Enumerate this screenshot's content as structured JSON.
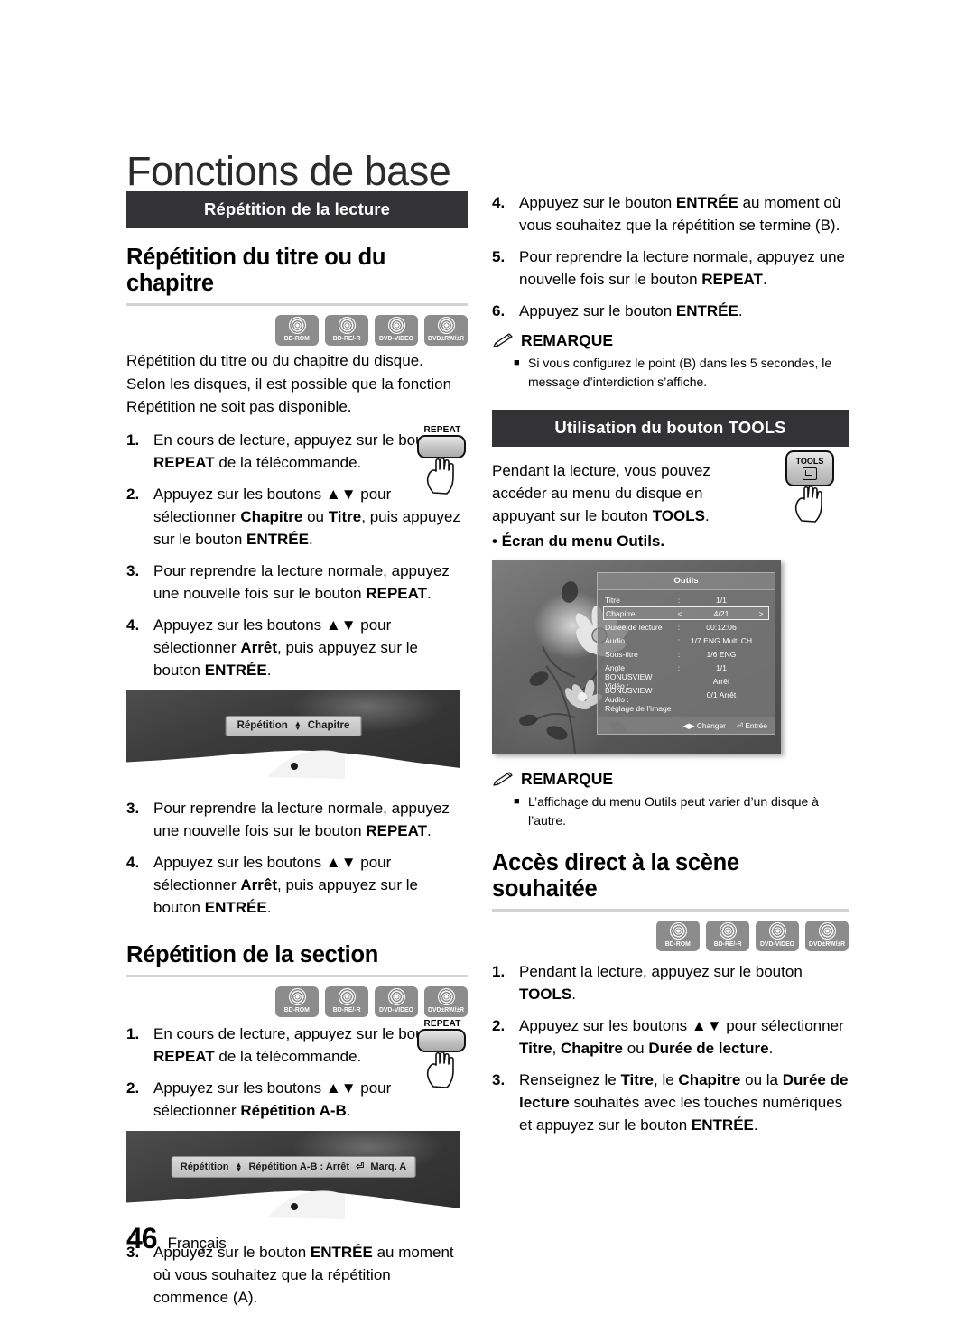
{
  "page": {
    "title": "Fonctions de base",
    "folio": "46",
    "language": "Français"
  },
  "disc_icons": [
    {
      "label": "BD-ROM"
    },
    {
      "label": "BD-RE/-R"
    },
    {
      "label": "DVD-VIDEO"
    },
    {
      "label": "DVD±RW/±R"
    }
  ],
  "left": {
    "section_bar": "Répétition de la lecture",
    "heading1": "Répétition du titre ou du chapitre",
    "intro1": "Répétition du titre ou du chapitre du disque.",
    "intro2": "Selon les disques, il est possible que la fonction Répétition ne soit pas disponible.",
    "steps": [
      {
        "num": "1.",
        "parts": [
          {
            "t": "En cours de lecture, appuyez sur le bouton "
          },
          {
            "t": "REPEAT",
            "b": true
          },
          {
            "t": " de la télécommande."
          }
        ]
      },
      {
        "num": "2.",
        "parts": [
          {
            "t": "Appuyez sur les boutons ▲▼ pour sélectionner "
          },
          {
            "t": "Chapitre",
            "b": true
          },
          {
            "t": " ou "
          },
          {
            "t": "Titre",
            "b": true
          },
          {
            "t": ", puis appuyez sur le bouton "
          },
          {
            "t": "ENTRÉE",
            "b": true
          },
          {
            "t": "."
          }
        ]
      },
      {
        "num": "3.",
        "parts": [
          {
            "t": "Pour reprendre la lecture normale, appuyez une nouvelle fois sur le bouton "
          },
          {
            "t": "REPEAT",
            "b": true
          },
          {
            "t": "."
          }
        ]
      },
      {
        "num": "4.",
        "parts": [
          {
            "t": "Appuyez sur les boutons ▲▼ pour sélectionner "
          },
          {
            "t": "Arrêt",
            "b": true
          },
          {
            "t": ", puis appuyez sur le bouton "
          },
          {
            "t": "ENTRÉE",
            "b": true
          },
          {
            "t": "."
          }
        ]
      }
    ],
    "osd1": {
      "label": "Répétition",
      "value": "Chapitre"
    },
    "heading2": "Répétition de la section",
    "steps2": [
      {
        "num": "1.",
        "parts": [
          {
            "t": "En cours de lecture, appuyez sur le bouton "
          },
          {
            "t": "REPEAT",
            "b": true
          },
          {
            "t": " de la télécommande."
          }
        ]
      },
      {
        "num": "2.",
        "parts": [
          {
            "t": "Appuyez sur les boutons ▲▼ pour sélectionner "
          },
          {
            "t": "Répétition A-B",
            "b": true
          },
          {
            "t": "."
          }
        ]
      },
      {
        "num": "3.",
        "parts": [
          {
            "t": "Appuyez sur le bouton "
          },
          {
            "t": "ENTRÉE",
            "b": true
          },
          {
            "t": " au moment où vous souhaitez que la répétition commence (A)."
          }
        ]
      }
    ],
    "osd2": {
      "label": "Répétition",
      "value": "Répétition A-B : Arrêt",
      "extra": "Marq. A"
    },
    "repeat_key_label": "REPEAT"
  },
  "right": {
    "steps_top": [
      {
        "num": "4.",
        "parts": [
          {
            "t": "Appuyez sur le bouton "
          },
          {
            "t": "ENTRÉE",
            "b": true
          },
          {
            "t": " au moment où vous souhaitez que la répétition se termine (B)."
          }
        ]
      },
      {
        "num": "5.",
        "parts": [
          {
            "t": "Pour reprendre la lecture normale, appuyez une nouvelle fois sur le bouton "
          },
          {
            "t": "REPEAT",
            "b": true
          },
          {
            "t": "."
          }
        ]
      },
      {
        "num": "6.",
        "parts": [
          {
            "t": "Appuyez sur le bouton "
          },
          {
            "t": "ENTRÉE",
            "b": true
          },
          {
            "t": "."
          }
        ]
      }
    ],
    "note1_head": "REMARQUE",
    "note1_items": [
      "Si vous configurez le point (B) dans les 5 secondes, le message d’interdiction s’affiche."
    ],
    "section_bar": "Utilisation du bouton TOOLS",
    "tools_para": [
      {
        "t": "Pendant la lecture, vous pouvez accéder au menu du disque en appuyant sur le bouton "
      },
      {
        "t": "TOOLS",
        "b": true
      },
      {
        "t": "."
      }
    ],
    "tools_key_label": "TOOLS",
    "bullet_line": "• Écran du menu Outils.",
    "note2_head": "REMARQUE",
    "note2_items": [
      "L’affichage du menu Outils peut varier d’un disque à l’autre."
    ],
    "heading3": "Accès direct à la scène souhaitée",
    "steps_bottom": [
      {
        "num": "1.",
        "parts": [
          {
            "t": "Pendant la lecture, appuyez sur le bouton "
          },
          {
            "t": "TOOLS",
            "b": true
          },
          {
            "t": "."
          }
        ]
      },
      {
        "num": "2.",
        "parts": [
          {
            "t": "Appuyez sur les boutons ▲▼ pour sélectionner "
          },
          {
            "t": "Titre",
            "b": true
          },
          {
            "t": ", "
          },
          {
            "t": "Chapitre",
            "b": true
          },
          {
            "t": " ou "
          },
          {
            "t": "Durée de lecture",
            "b": true
          },
          {
            "t": "."
          }
        ]
      },
      {
        "num": "3.",
        "parts": [
          {
            "t": "Renseignez le "
          },
          {
            "t": "Titre",
            "b": true
          },
          {
            "t": ", le "
          },
          {
            "t": "Chapitre",
            "b": true
          },
          {
            "t": " ou la "
          },
          {
            "t": "Durée de lecture",
            "b": true
          },
          {
            "t": " souhaités avec les touches numériques et appuyez sur le bouton "
          },
          {
            "t": "ENTRÉE",
            "b": true
          },
          {
            "t": "."
          }
        ]
      }
    ]
  },
  "tools_menu": {
    "title": "Outils",
    "rows": [
      {
        "label": "Titre",
        "sep": ":",
        "value": "1/1",
        "selected": false
      },
      {
        "label": "Chapitre",
        "sep": "<",
        "value": "4/21",
        "right": ">",
        "selected": true
      },
      {
        "label": "Durée de lecture",
        "sep": ":",
        "value": "00:12:06",
        "selected": false
      },
      {
        "label": "Audio",
        "sep": ":",
        "value": "1/7 ENG Multi CH",
        "selected": false
      },
      {
        "label": "Sous-titre",
        "sep": ":",
        "value": "1/6 ENG",
        "selected": false
      },
      {
        "label": "Angle",
        "sep": ":",
        "value": "1/1",
        "selected": false
      },
      {
        "label": "BONUSVIEW Vidéo :",
        "sep": "",
        "value": "Arrêt",
        "selected": false
      },
      {
        "label": "BONUSVIEW Audio :",
        "sep": "",
        "value": "0/1 Arrêt",
        "selected": false
      },
      {
        "label": "Réglage de l’image",
        "sep": "",
        "value": "",
        "selected": false
      }
    ],
    "footer": [
      {
        "icon": "◀▶",
        "label": "Changer"
      },
      {
        "icon": "⏎",
        "label": "Entrée"
      }
    ]
  },
  "colors": {
    "section_bar_bg": "#333335",
    "rule": "#d2d2d2",
    "disc_chip": "#8c8c8c"
  }
}
